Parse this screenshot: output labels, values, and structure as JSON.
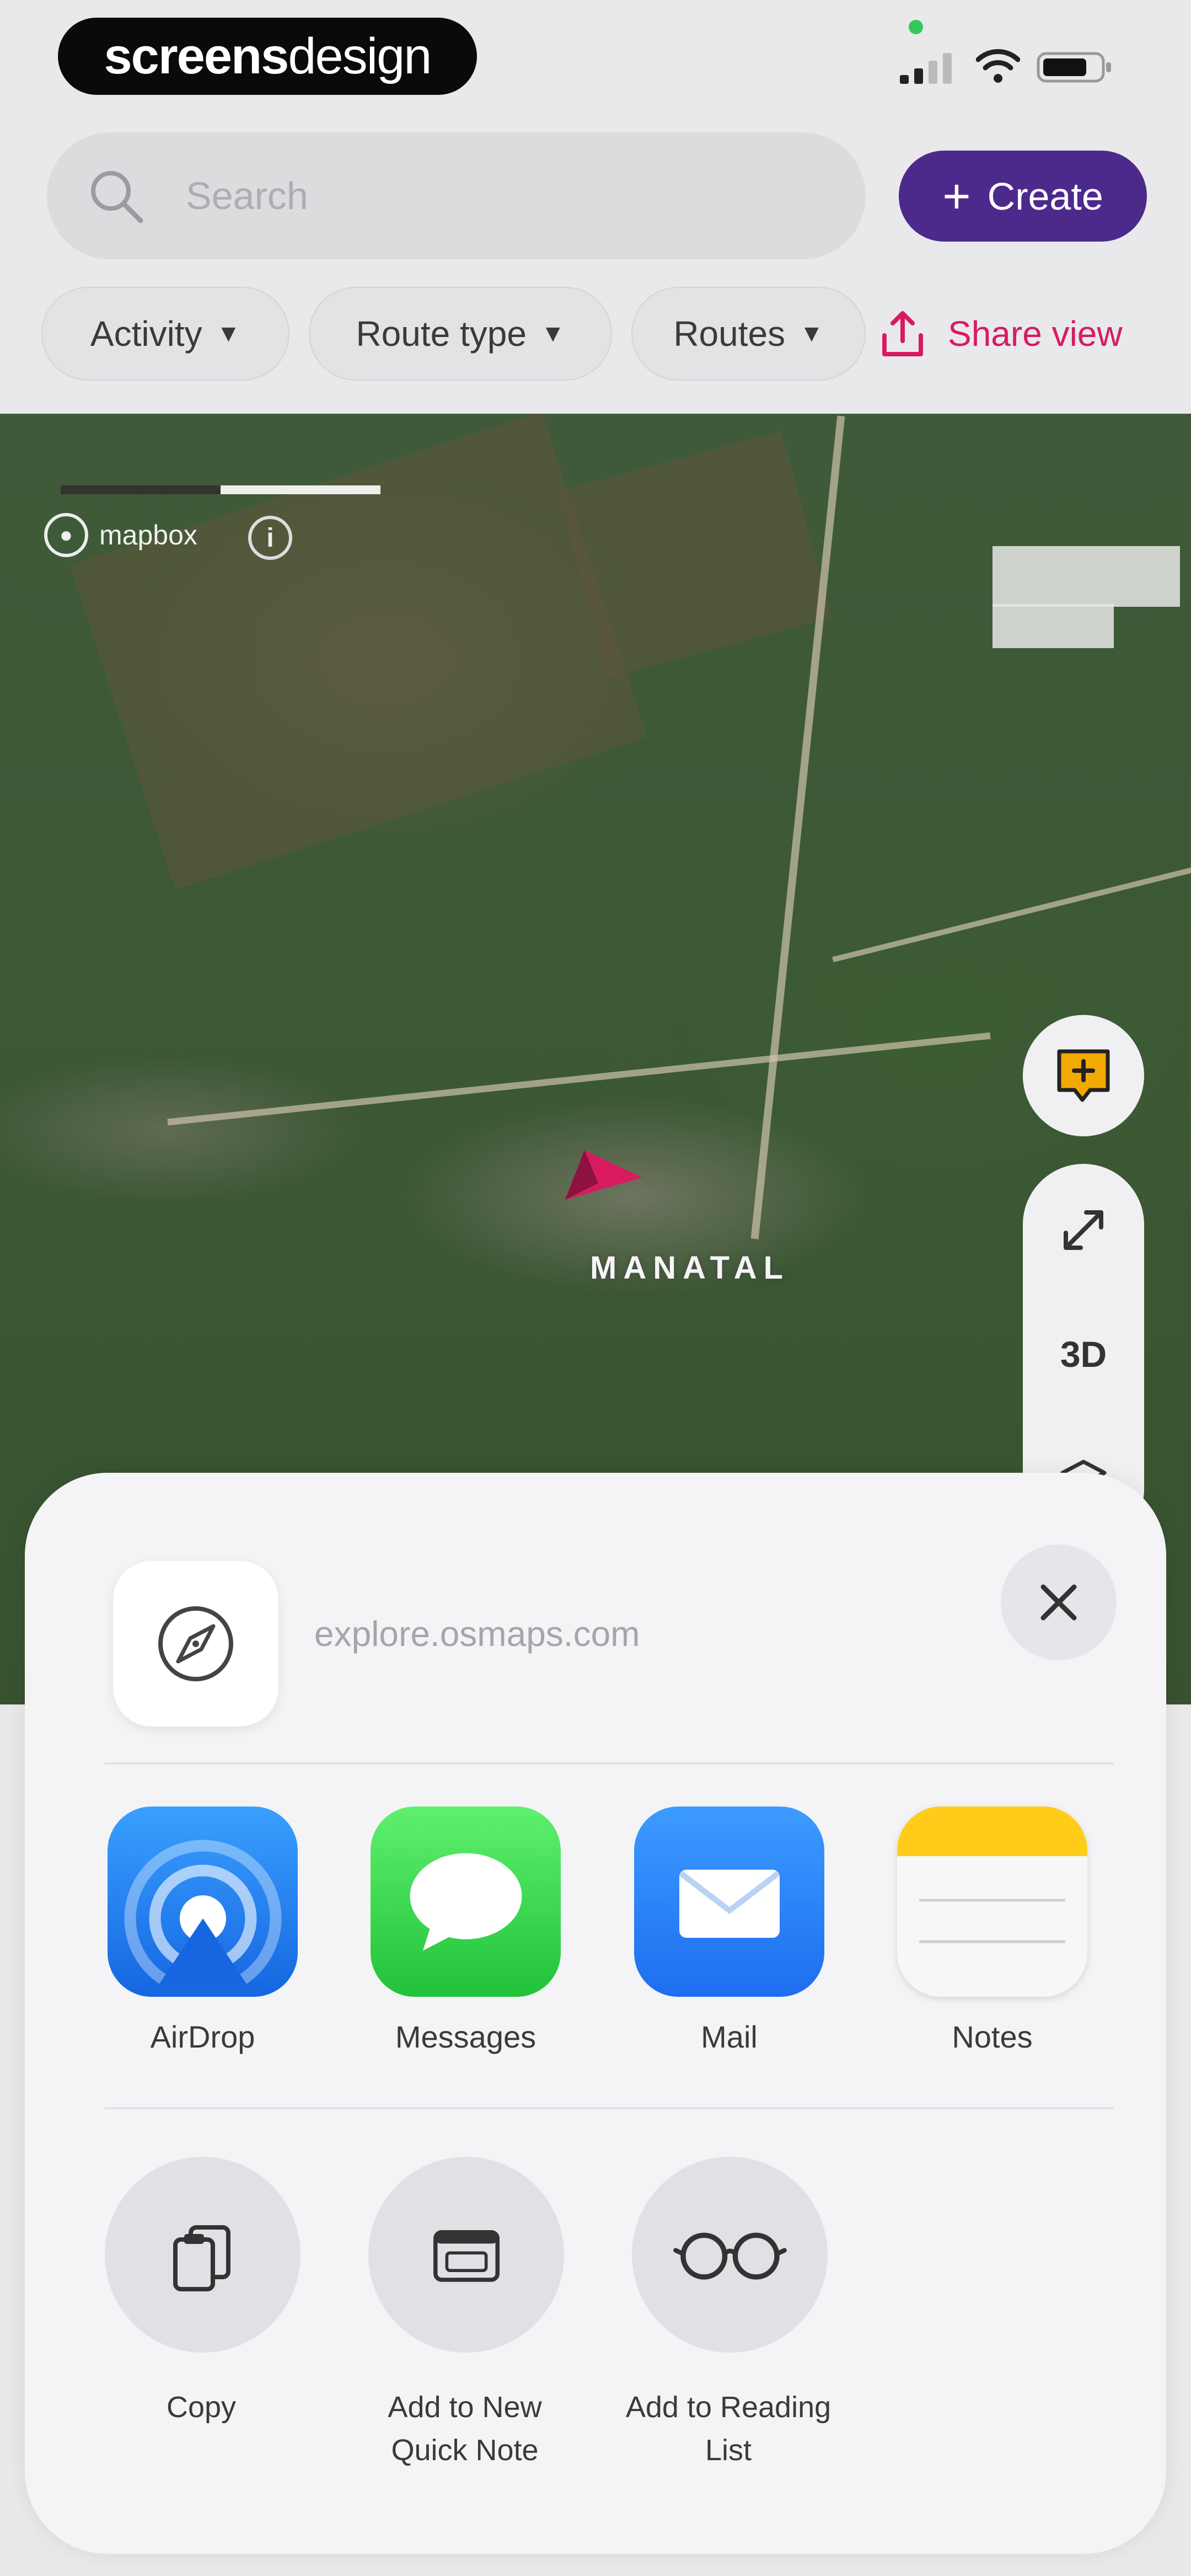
{
  "status_bar": {
    "brand_part1": "screens",
    "brand_part2": "design"
  },
  "header": {
    "search_placeholder": "Search",
    "create_label": "Create",
    "filters": [
      {
        "label": "Activity"
      },
      {
        "label": "Route type"
      },
      {
        "label": "Routes"
      }
    ],
    "share_view_label": "Share view"
  },
  "map": {
    "attribution": "mapbox",
    "place_label": "MANATAL",
    "controls": {
      "three_d_label": "3D"
    }
  },
  "share_sheet": {
    "site_url": "explore.osmaps.com",
    "apps": [
      {
        "label": "AirDrop",
        "icon": "airdrop-icon"
      },
      {
        "label": "Messages",
        "icon": "messages-icon"
      },
      {
        "label": "Mail",
        "icon": "mail-icon"
      },
      {
        "label": "Notes",
        "icon": "notes-icon"
      }
    ],
    "actions": [
      {
        "label": "Copy",
        "icon": "copy-icon"
      },
      {
        "label": "Add to New Quick Note",
        "icon": "quick-note-icon"
      },
      {
        "label": "Add to Reading List",
        "icon": "glasses-icon"
      }
    ]
  },
  "colors": {
    "create_button": "#4c2a8c",
    "share_view": "#d81b60",
    "location_arrow": "#d81b60"
  }
}
